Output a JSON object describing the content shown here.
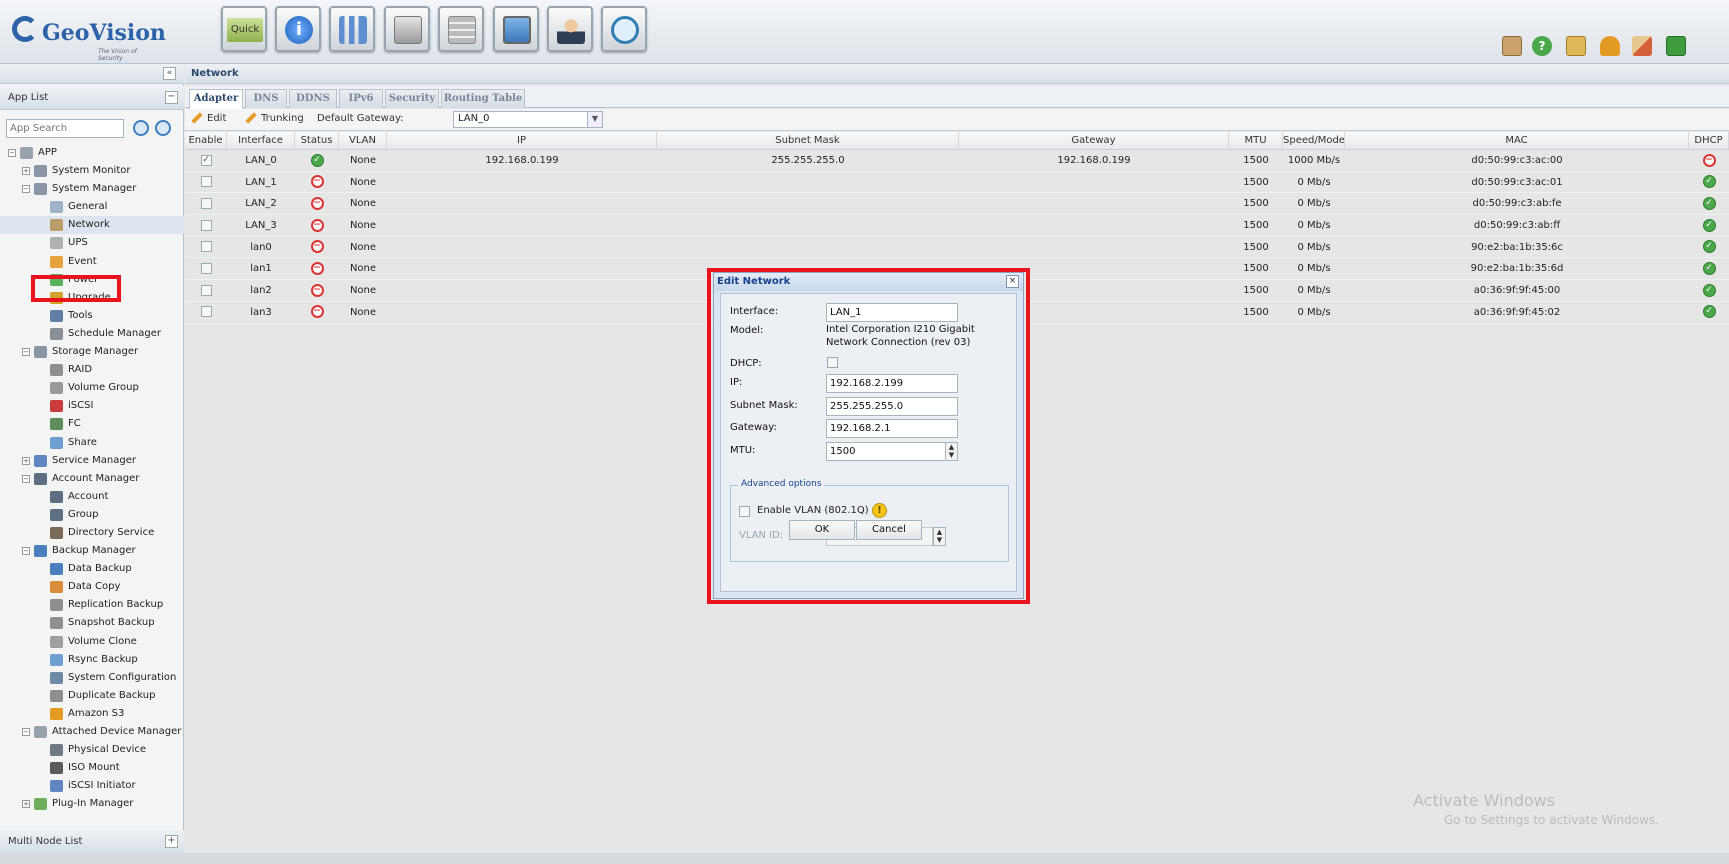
{
  "header": {
    "logo_text": "GeoVision",
    "logo_tagline": "The Vision of Security",
    "app_buttons": [
      "quick",
      "info",
      "chart",
      "disk",
      "storage",
      "monitor",
      "user",
      "backup"
    ],
    "quick_label": "Quick",
    "right_icons": [
      "picture-icon",
      "help-icon",
      "folder-icon",
      "bell-icon",
      "home-icon",
      "logout-icon"
    ]
  },
  "sidebar": {
    "collapse_label": "«",
    "title": "App List",
    "minimize_label": "−",
    "search_placeholder": "App Search",
    "tree": [
      {
        "label": "APP",
        "level": 0,
        "exp": "−",
        "icon": "app-icon",
        "color": "#9aa3ad"
      },
      {
        "label": "System Monitor",
        "level": 1,
        "exp": "+",
        "icon": "system-monitor-icon",
        "color": "#8a96a5"
      },
      {
        "label": "System Manager",
        "level": 1,
        "exp": "−",
        "icon": "system-manager-icon",
        "color": "#8a96a5"
      },
      {
        "label": "General",
        "level": 2,
        "icon": "general-icon",
        "color": "#9fb3c8"
      },
      {
        "label": "Network",
        "level": 2,
        "icon": "network-icon",
        "color": "#b99d6a",
        "selected": true
      },
      {
        "label": "UPS",
        "level": 2,
        "icon": "ups-icon",
        "color": "#b0b0b0"
      },
      {
        "label": "Event",
        "level": 2,
        "icon": "event-icon",
        "color": "#e6a23c"
      },
      {
        "label": "Power",
        "level": 2,
        "icon": "power-icon",
        "color": "#5bb05b"
      },
      {
        "label": "Upgrade",
        "level": 2,
        "icon": "upgrade-icon",
        "color": "#d4a12a"
      },
      {
        "label": "Tools",
        "level": 2,
        "icon": "tools-icon",
        "color": "#5f7ea8"
      },
      {
        "label": "Schedule Manager",
        "level": 2,
        "icon": "schedule-icon",
        "color": "#8a8f96"
      },
      {
        "label": "Storage Manager",
        "level": 1,
        "exp": "−",
        "icon": "storage-manager-icon",
        "color": "#8a96a5"
      },
      {
        "label": "RAID",
        "level": 2,
        "icon": "raid-icon",
        "color": "#8f8f8f"
      },
      {
        "label": "Volume Group",
        "level": 2,
        "icon": "volume-group-icon",
        "color": "#9a9a9a"
      },
      {
        "label": "iSCSI",
        "level": 2,
        "icon": "iscsi-icon",
        "color": "#cc3b3b"
      },
      {
        "label": "FC",
        "level": 2,
        "icon": "fc-icon",
        "color": "#5c8f5c"
      },
      {
        "label": "Share",
        "level": 2,
        "icon": "share-icon",
        "color": "#6f9fd0"
      },
      {
        "label": "Service Manager",
        "level": 1,
        "exp": "+",
        "icon": "service-manager-icon",
        "color": "#5f86c0"
      },
      {
        "label": "Account Manager",
        "level": 1,
        "exp": "−",
        "icon": "account-manager-icon",
        "color": "#5e6f84"
      },
      {
        "label": "Account",
        "level": 2,
        "icon": "account-icon",
        "color": "#5e6f84"
      },
      {
        "label": "Group",
        "level": 2,
        "icon": "group-icon",
        "color": "#5e6f84"
      },
      {
        "label": "Directory Service",
        "level": 2,
        "icon": "directory-service-icon",
        "color": "#7a6a5a"
      },
      {
        "label": "Backup Manager",
        "level": 1,
        "exp": "−",
        "icon": "backup-manager-icon",
        "color": "#4a7fbf"
      },
      {
        "label": "Data Backup",
        "level": 2,
        "icon": "data-backup-icon",
        "color": "#4a7fbf"
      },
      {
        "label": "Data Copy",
        "level": 2,
        "icon": "data-copy-icon",
        "color": "#d98c3a"
      },
      {
        "label": "Replication Backup",
        "level": 2,
        "icon": "replication-backup-icon",
        "color": "#8f8f8f"
      },
      {
        "label": "Snapshot Backup",
        "level": 2,
        "icon": "snapshot-backup-icon",
        "color": "#8f8f8f"
      },
      {
        "label": "Volume Clone",
        "level": 2,
        "icon": "volume-clone-icon",
        "color": "#a0a0a0"
      },
      {
        "label": "Rsync Backup",
        "level": 2,
        "icon": "rsync-backup-icon",
        "color": "#6f9fd0"
      },
      {
        "label": "System Configuration",
        "level": 2,
        "icon": "system-configuration-icon",
        "color": "#6f8aa8"
      },
      {
        "label": "Duplicate Backup",
        "level": 2,
        "icon": "duplicate-backup-icon",
        "color": "#8f8f8f"
      },
      {
        "label": "Amazon S3",
        "level": 2,
        "icon": "amazon-s3-icon",
        "color": "#e39b25"
      },
      {
        "label": "Attached Device Manager",
        "level": 1,
        "exp": "−",
        "icon": "attached-device-manager-icon",
        "color": "#9aa3ad"
      },
      {
        "label": "Physical Device",
        "level": 2,
        "icon": "physical-device-icon",
        "color": "#6f7a86"
      },
      {
        "label": "ISO Mount",
        "level": 2,
        "icon": "iso-mount-icon",
        "color": "#5a5a5a"
      },
      {
        "label": "iSCSI Initiator",
        "level": 2,
        "icon": "iscsi-initiator-icon",
        "color": "#5f86c0"
      },
      {
        "label": "Plug-In Manager",
        "level": 1,
        "exp": "+",
        "icon": "plug-in-manager-icon",
        "color": "#6fae5a"
      }
    ],
    "multi_node_title": "Multi Node List",
    "multi_node_btn": "+"
  },
  "main": {
    "title": "Network",
    "tabs": [
      "Adapter",
      "DNS",
      "DDNS",
      "IPv6",
      "Security",
      "Routing Table"
    ],
    "active_tab": "Adapter",
    "toolbar": {
      "edit": "Edit",
      "trunking": "Trunking",
      "gateway_label": "Default Gateway:",
      "gateway_value": "LAN_0"
    },
    "grid": {
      "columns": [
        "Enable",
        "Interface",
        "Status",
        "VLAN",
        "IP",
        "Subnet Mask",
        "Gateway",
        "MTU",
        "Speed/Mode",
        "MAC",
        "DHCP"
      ],
      "rows": [
        {
          "enabled": true,
          "interface": "LAN_0",
          "status": "ok",
          "vlan": "None",
          "ip": "192.168.0.199",
          "mask": "255.255.255.0",
          "gateway": "192.168.0.199",
          "mtu": "1500",
          "speed": "1000 Mb/s",
          "mac": "d0:50:99:c3:ac:00",
          "dhcp": "no"
        },
        {
          "enabled": false,
          "interface": "LAN_1",
          "status": "no",
          "vlan": "None",
          "ip": "",
          "mask": "",
          "gateway": "",
          "mtu": "1500",
          "speed": "0 Mb/s",
          "mac": "d0:50:99:c3:ac:01",
          "dhcp": "ok"
        },
        {
          "enabled": false,
          "interface": "LAN_2",
          "status": "no",
          "vlan": "None",
          "ip": "",
          "mask": "",
          "gateway": "",
          "mtu": "1500",
          "speed": "0 Mb/s",
          "mac": "d0:50:99:c3:ab:fe",
          "dhcp": "ok"
        },
        {
          "enabled": false,
          "interface": "LAN_3",
          "status": "no",
          "vlan": "None",
          "ip": "",
          "mask": "",
          "gateway": "",
          "mtu": "1500",
          "speed": "0 Mb/s",
          "mac": "d0:50:99:c3:ab:ff",
          "dhcp": "ok"
        },
        {
          "enabled": false,
          "interface": "lan0",
          "status": "no",
          "vlan": "None",
          "ip": "",
          "mask": "",
          "gateway": "",
          "mtu": "1500",
          "speed": "0 Mb/s",
          "mac": "90:e2:ba:1b:35:6c",
          "dhcp": "ok"
        },
        {
          "enabled": false,
          "interface": "lan1",
          "status": "no",
          "vlan": "None",
          "ip": "",
          "mask": "",
          "gateway": "",
          "mtu": "1500",
          "speed": "0 Mb/s",
          "mac": "90:e2:ba:1b:35:6d",
          "dhcp": "ok"
        },
        {
          "enabled": false,
          "interface": "lan2",
          "status": "no",
          "vlan": "None",
          "ip": "",
          "mask": "",
          "gateway": "",
          "mtu": "1500",
          "speed": "0 Mb/s",
          "mac": "a0:36:9f:9f:45:00",
          "dhcp": "ok"
        },
        {
          "enabled": false,
          "interface": "lan3",
          "status": "no",
          "vlan": "None",
          "ip": "",
          "mask": "",
          "gateway": "",
          "mtu": "1500",
          "speed": "0 Mb/s",
          "mac": "a0:36:9f:9f:45:02",
          "dhcp": "ok"
        }
      ]
    }
  },
  "dialog": {
    "title": "Edit Network",
    "close": "×",
    "interface_label": "Interface:",
    "interface_value": "LAN_1",
    "model_label": "Model:",
    "model_value": "Intel Corporation I210 Gigabit Network Connection (rev 03)",
    "dhcp_label": "DHCP:",
    "ip_label": "IP:",
    "ip_value": "192.168.2.199",
    "mask_label": "Subnet Mask:",
    "mask_value": "255.255.255.0",
    "gateway_label": "Gateway:",
    "gateway_value": "192.168.2.1",
    "mtu_label": "MTU:",
    "mtu_value": "1500",
    "advanced_legend": "Advanced options",
    "vlan_enable_label": "Enable VLAN (802.1Q)",
    "vlan_id_label": "VLAN ID:",
    "vlan_id_value": "1",
    "ok": "OK",
    "cancel": "Cancel"
  },
  "watermark": {
    "line1": "Activate Windows",
    "line2": "Go to Settings to activate Windows."
  },
  "colors": {
    "highlight": "#e8131d",
    "brand": "#2c62a8",
    "ok": "#4aa84a",
    "error": "#d33333"
  }
}
